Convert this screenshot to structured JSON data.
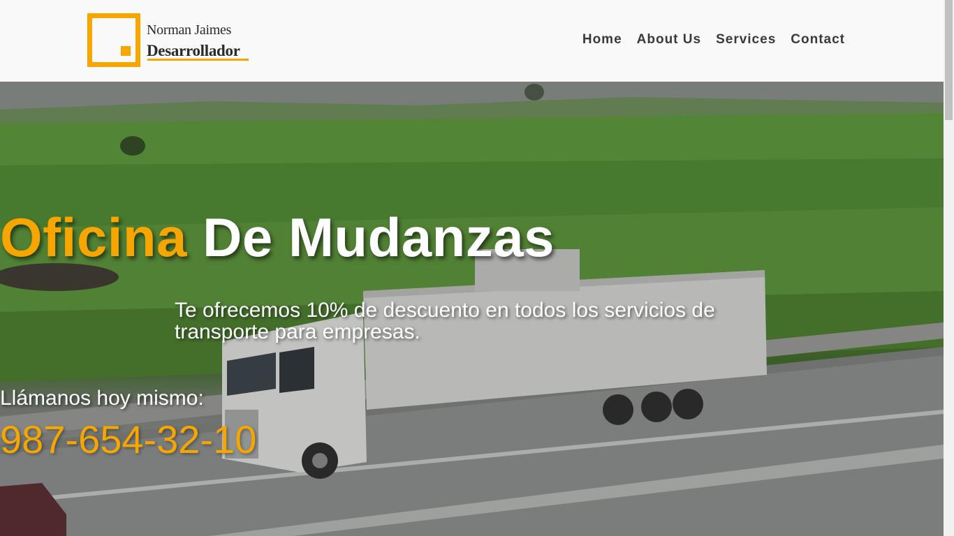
{
  "brand": {
    "name": "Norman Jaimes",
    "role": "Desarrollador",
    "accent_color": "#f7a600"
  },
  "nav": {
    "items": [
      {
        "label": "Home"
      },
      {
        "label": "About Us"
      },
      {
        "label": "Services"
      },
      {
        "label": "Contact"
      }
    ]
  },
  "hero": {
    "title_accent": "Oficina",
    "title_rest": "De Mudanzas",
    "subtitle": "Te ofrecemos 10% de descuento en todos los servicios de transporte para empresas.",
    "call_label": "Llámanos hoy mismo:",
    "phone": "987-654-32-10",
    "background_image": "truck-on-highway-photo"
  }
}
